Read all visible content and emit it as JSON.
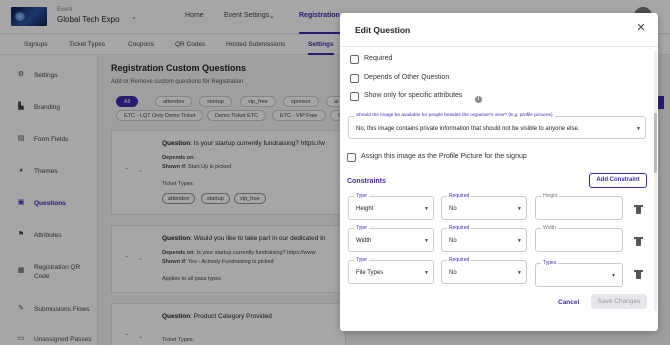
{
  "header": {
    "event_small_label": "Event",
    "event_name": "Global Tech Expo",
    "nav": [
      "Home",
      "Event Settings",
      "Registration"
    ],
    "active_nav": "Registration"
  },
  "subtabs": [
    "Signups",
    "Ticket Types",
    "Coupons",
    "QR Codes",
    "Hosted Submissions",
    "Settings"
  ],
  "sidebar": {
    "items": [
      {
        "label": "Settings",
        "icon": "gear-icon"
      },
      {
        "label": "Branding",
        "icon": "brush-icon"
      },
      {
        "label": "Form Fields",
        "icon": "form-icon"
      },
      {
        "label": "Themes",
        "icon": "palette-icon"
      },
      {
        "label": "Questions",
        "icon": "questions-icon"
      },
      {
        "label": "Attributes",
        "icon": "flag-icon"
      },
      {
        "label": "Registration QR Code",
        "icon": "qr-icon"
      },
      {
        "label": "Submissions Flows",
        "icon": "flow-icon"
      },
      {
        "label": "Unassigned Passes",
        "icon": "passes-icon"
      }
    ],
    "active": "Questions"
  },
  "main": {
    "title": "Registration Custom Questions",
    "subtitle": "Add or Remove custom questions for Registration",
    "filters_row1": [
      "All",
      "attendee",
      "startup",
      "vip_free",
      "sponsor",
      "at"
    ],
    "filters_row2": [
      "ETC - LQT Only Demo Ticket",
      "Demo Ticket ETC",
      "ETC - VIP Free",
      "O"
    ],
    "questions": [
      {
        "question_label": "Question",
        "question_text": ": Is your startup currently fundraising? https://w",
        "depends_label": "Depends on",
        "depends_text": "",
        "shown_if_label": "Shown if",
        "shown_if_text": ": Start Up is picked",
        "ticket_types_label": "Ticket Types:",
        "tags": [
          "attendee",
          "startup",
          "vip_free"
        ]
      },
      {
        "question_label": "Question",
        "question_text": ": Would you like to take part in our dedicated In",
        "depends_label": "Depends on",
        "depends_text": ": Is your startup currently fundraising? https://www",
        "shown_if_label": "Shown if",
        "shown_if_text": ": Yes - Actively Fundraising is picked",
        "applies_text": "Applies to all pass types"
      },
      {
        "question_label": "Question",
        "question_text": ": Product Category Provided",
        "ticket_types_label": "Ticket Types:"
      }
    ]
  },
  "modal": {
    "title": "Edit Question",
    "required_label": "Required",
    "depends_label": "Depends of Other Question",
    "specific_attr_label": "Show only for specific attributes",
    "visibility_field_label": "Should the image be available for people besides the organiser's view? (E.g. profile pictures)",
    "visibility_value": "No, this image contains private information that should not be visible to anyone else.",
    "profile_picture_label": "Assign this image as the Profile Picture for the signup",
    "constraints_title": "Constraints",
    "add_constraint_label": "Add Constraint",
    "constraints": [
      {
        "type_label": "Type",
        "type_value": "Height",
        "required_label": "Required",
        "required_value": "No",
        "value_label": "Height",
        "value": ""
      },
      {
        "type_label": "Type",
        "type_value": "Width",
        "required_label": "Required",
        "required_value": "No",
        "value_label": "Width",
        "value": ""
      },
      {
        "type_label": "Type",
        "type_value": "File Types",
        "required_label": "Required",
        "required_value": "No",
        "value_label": "Types",
        "value": ""
      }
    ],
    "cancel_label": "Cancel",
    "save_label": "Save Changes"
  },
  "colors": {
    "accent": "#3d2bb0",
    "overlay": "rgba(0,0,0,0.35)"
  }
}
